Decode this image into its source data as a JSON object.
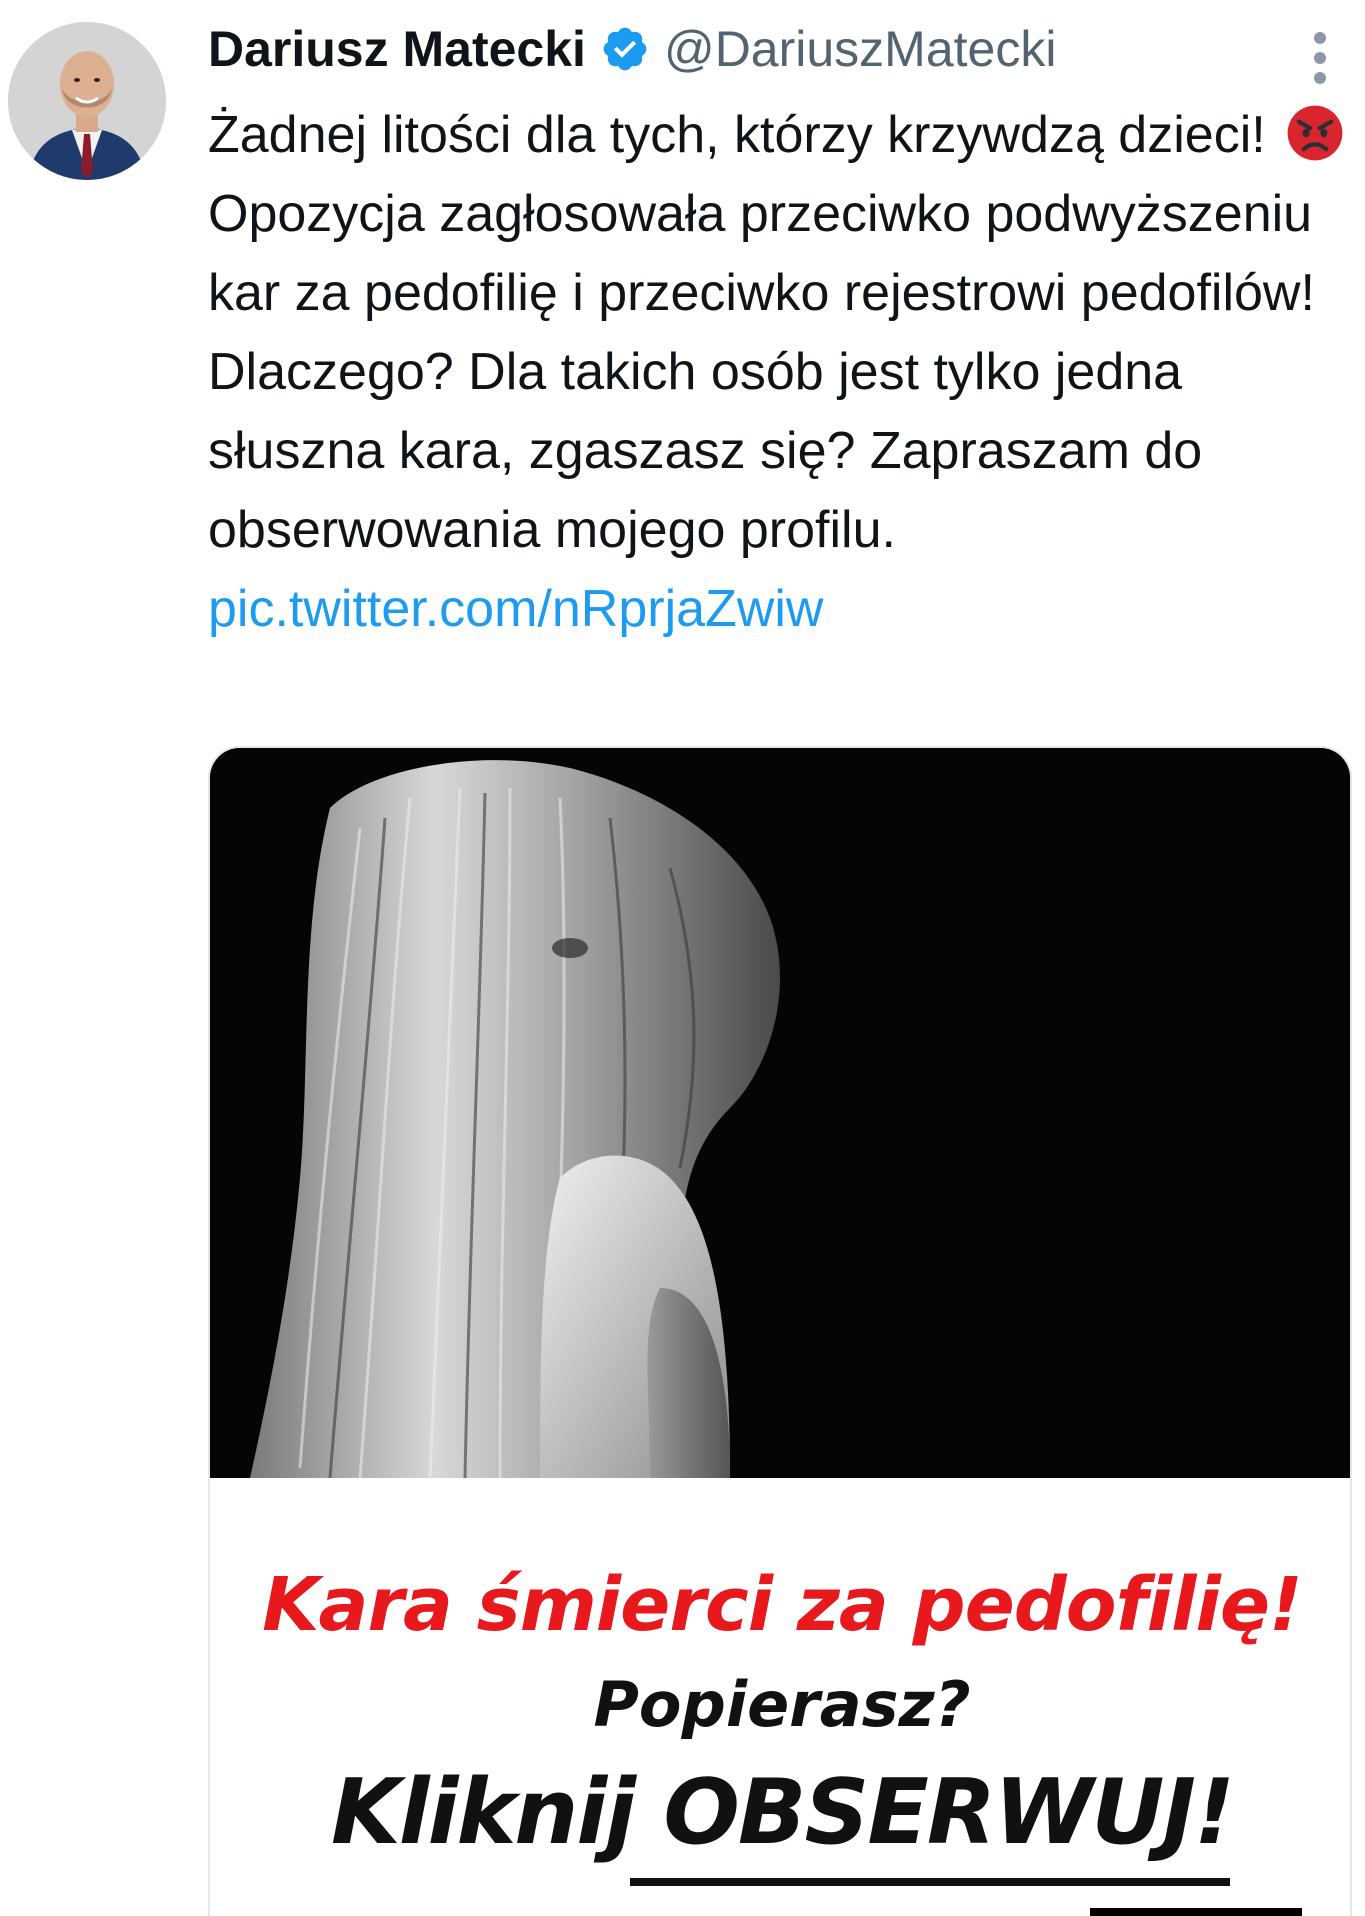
{
  "author": {
    "name": "Dariusz Matecki",
    "handle": "@DariuszMatecki",
    "verified": true,
    "avatar_icon": "profile-photo-avatar",
    "verified_color": "#1d9bf0"
  },
  "tweet": {
    "text_part1": "Żadnej litości dla tych, którzy krzywdzą dzieci! ",
    "emoji_name": "angry-face-icon",
    "text_part2": " Opozycja zagłosowała przeciwko podwyższeniu kar za pedofilię i przeciwko rejestrowi pedofilów! Dlaczego? Dla takich osób jest tylko jedna słuszna kara, zgaszasz się? Zapraszam do obserwowania mojego profilu. ",
    "link": "pic.twitter.com/nRprjaZwiw",
    "link_color": "#1d9bf0"
  },
  "media": {
    "caption_line1": "Kara śmierci za pedofilię!",
    "caption_line2": "Popierasz?",
    "caption_line3_a": "Kliknij ",
    "caption_line3_b": "OBSERWUJ!",
    "caption_line1_color": "#e8191c"
  }
}
